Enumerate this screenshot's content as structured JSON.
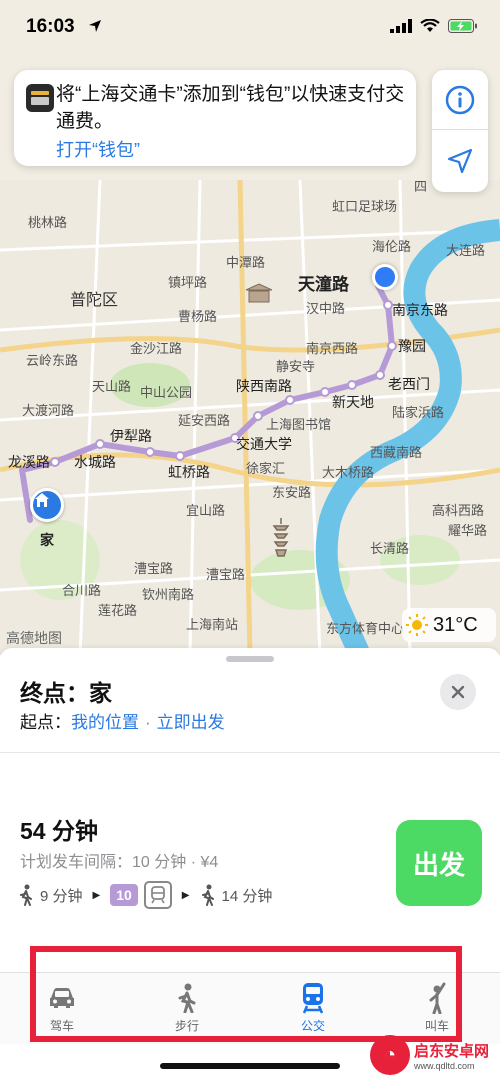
{
  "status_bar": {
    "time": "16:03"
  },
  "wallet_banner": {
    "text": "将“上海交通卡”添加到“钱包”以快速支付交通费。",
    "link": "打开“钱包”"
  },
  "map": {
    "attribution": "高德地图",
    "weather": {
      "temp": "31°C",
      "icon": "sun-icon"
    },
    "labels": {
      "putuo": "普陀区",
      "tongtan": "天潼路",
      "home": "家",
      "taolin": "桃林路",
      "hongkou": "虹口足球场",
      "hailun": "海伦路",
      "daliang": "大连路",
      "zhongtan": "中潭路",
      "hanzhong": "汉中路",
      "nanjing_east": "南京东路",
      "zhenping": "镇坪路",
      "caoyang": "曹杨路",
      "jinshajiang": "金沙江路",
      "nanjing_west": "南京西路",
      "yuyuan": "豫园",
      "yunling": "云岭东路",
      "daduhe": "大渡河路",
      "tianshan": "天山路",
      "zhongshan_park": "中山公园",
      "jingan": "静安寺",
      "shaanxi_south": "陕西南路",
      "laoximen": "老西门",
      "xintiandi": "新天地",
      "lujiabang": "陆家浜路",
      "yanan_west": "延安西路",
      "shanghai_library": "上海图书馆",
      "yili": "伊犁路",
      "jiaotong_univ": "交通大学",
      "xizang_south": "西藏南路",
      "longxi": "龙溪路",
      "shuicheng": "水城路",
      "hongqiao": "虹桥路",
      "xujiahui": "徐家汇",
      "damuqiao": "大木桥路",
      "yishan": "宜山路",
      "dongan": "东安路",
      "gaoke_west": "高科西路",
      "yaohua": "耀华路",
      "caobao": "漕宝路",
      "caobao2": "漕宝路",
      "changqing": "长清路",
      "hechuan": "合川路",
      "lianhua": "莲花路",
      "qinzhou_south": "钦州南路",
      "shanghai_south": "上海南站",
      "dongfang_sports": "东方体育中心",
      "si": "四"
    }
  },
  "sheet": {
    "destination_prefix": "终点：",
    "destination": "家",
    "origin_prefix": "起点：",
    "origin": "我的位置",
    "separator": "·",
    "depart": "立即出发",
    "route": {
      "duration": "54 分钟",
      "subtitle": "计划发车间隔：10 分钟 · ¥4",
      "walk1": "9 分钟",
      "line": "10",
      "walk2": "14 分钟"
    },
    "go_label": "出发"
  },
  "tabs": [
    {
      "label": "驾车",
      "icon": "car-icon"
    },
    {
      "label": "步行",
      "icon": "walk-icon"
    },
    {
      "label": "公交",
      "icon": "train-icon",
      "active": true
    },
    {
      "label": "叫车",
      "icon": "hail-icon"
    }
  ],
  "watermark": {
    "title": "启东安卓网",
    "url": "www.qdltd.com"
  },
  "colors": {
    "accent_blue": "#2a7ae2",
    "go_green": "#4cd964",
    "route_purple": "#b59ad6",
    "highlight_red": "#e8213a",
    "river": "#6cc3e8"
  }
}
